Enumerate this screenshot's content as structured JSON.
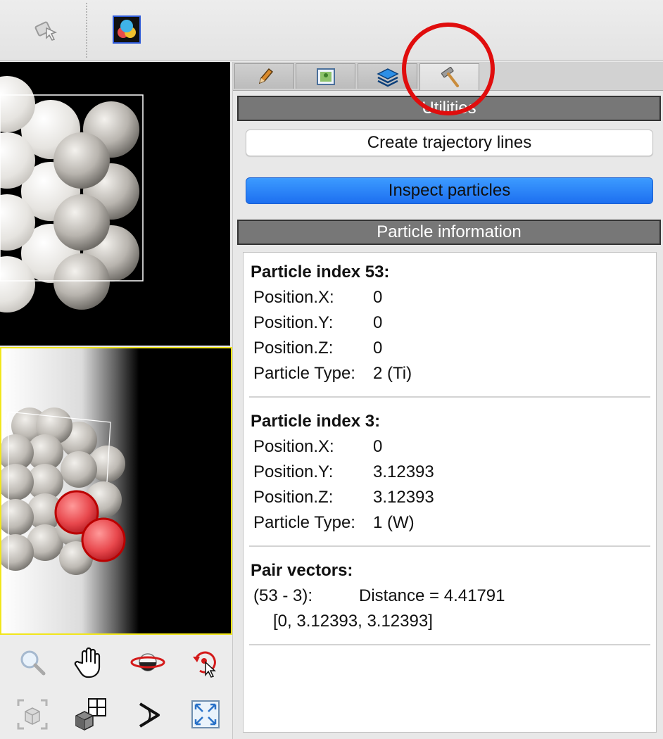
{
  "toolbar": {
    "icons": [
      "selection-mode-icon",
      "color-legend-icon"
    ]
  },
  "tabs": [
    {
      "icon": "pencil-icon",
      "active": false
    },
    {
      "icon": "render-image-icon",
      "active": false
    },
    {
      "icon": "layers-icon",
      "active": false
    },
    {
      "icon": "hammer-icon",
      "active": true
    }
  ],
  "utilities": {
    "header": "Utilities",
    "create_trajectory_label": "Create trajectory lines",
    "inspect_particles_label": "Inspect particles"
  },
  "particle_info": {
    "header": "Particle information",
    "particles": [
      {
        "title": "Particle index 53:",
        "props": [
          {
            "key": "Position.X:",
            "value": "0"
          },
          {
            "key": "Position.Y:",
            "value": "0"
          },
          {
            "key": "Position.Z:",
            "value": "0"
          },
          {
            "key": "Particle Type:",
            "value": "2 (Ti)"
          }
        ]
      },
      {
        "title": "Particle index 3:",
        "props": [
          {
            "key": "Position.X:",
            "value": "0"
          },
          {
            "key": "Position.Y:",
            "value": "3.12393"
          },
          {
            "key": "Position.Z:",
            "value": "3.12393"
          },
          {
            "key": "Particle Type:",
            "value": "1 (W)"
          }
        ]
      }
    ],
    "pair_vectors": {
      "title": "Pair vectors:",
      "pair": "(53 - 3):",
      "distance": "Distance = 4.41791",
      "vector": "[0, 3.12393, 3.12393]"
    }
  },
  "view_tools": [
    "zoom-icon",
    "pan-hand-icon",
    "orbit-icon",
    "pick-orbit-center-icon",
    "zoom-scene-extents-icon",
    "zoom-all-viewports-icon",
    "fov-icon",
    "maximize-viewport-icon"
  ],
  "colors": {
    "accent_blue": "#1d6ff0",
    "annotation_red": "#e00d0d",
    "active_viewport": "#f1e61c"
  }
}
